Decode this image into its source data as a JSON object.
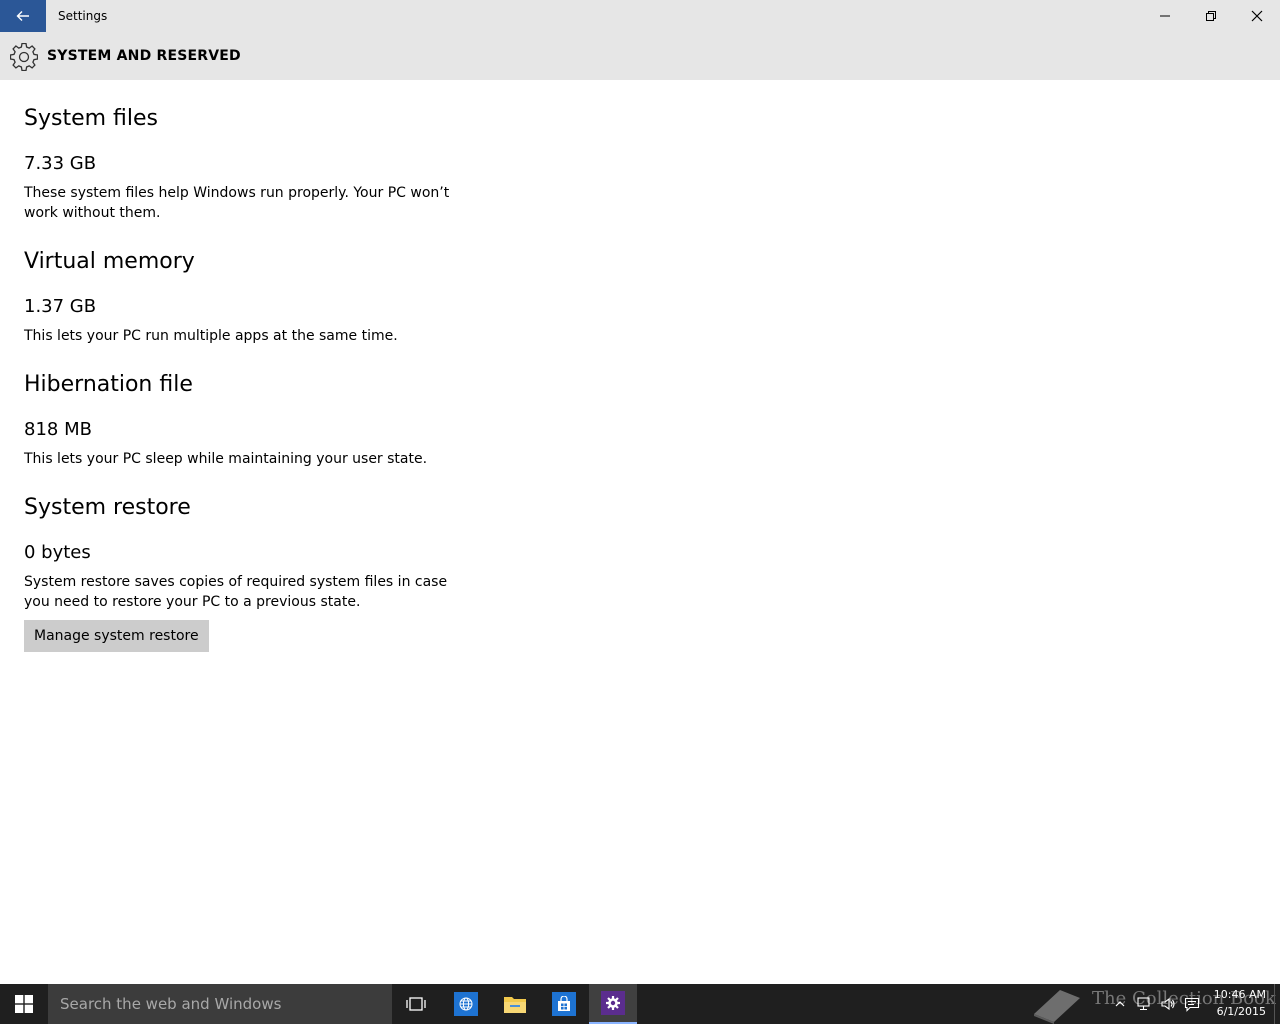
{
  "window": {
    "title": "Settings",
    "page_title": "SYSTEM AND RESERVED"
  },
  "sections": [
    {
      "title": "System files",
      "size": "7.33 GB",
      "description": "These system files help Windows run properly. Your PC won’t work without them."
    },
    {
      "title": "Virtual memory",
      "size": "1.37 GB",
      "description": "This lets your PC run multiple apps at the same time."
    },
    {
      "title": "Hibernation file",
      "size": "818 MB",
      "description": "This lets your PC sleep while maintaining your user state."
    },
    {
      "title": "System restore",
      "size": "0 bytes",
      "description": "System restore saves copies of required system files in case you need to restore your PC to a previous state.",
      "button_label": "Manage system restore"
    }
  ],
  "taskbar": {
    "search_placeholder": "Search the web and Windows",
    "watermark": "The Collection Book",
    "time": "10:46 AM",
    "date": "6/1/2015"
  },
  "icons": {
    "back": "back-arrow-icon",
    "minimize": "minimize-icon",
    "maximize": "restore-icon",
    "close": "close-icon",
    "settings": "gear-icon",
    "start": "windows-logo-icon",
    "task_view": "task-view-icon",
    "edge": "globe-icon",
    "explorer": "folder-icon",
    "store": "store-bag-icon",
    "tray_up": "chevron-up-icon",
    "network": "network-icon",
    "volume": "speaker-icon",
    "action_center": "message-icon"
  },
  "colors": {
    "accent": "#2b5797",
    "header_bg": "#e6e6e6",
    "button_bg": "#cccccc",
    "taskbar_bg": "#1f1f1f",
    "edge_tile": "#1e73d2",
    "store_tile": "#1e73d2",
    "settings_tile": "#5b2d8e"
  }
}
